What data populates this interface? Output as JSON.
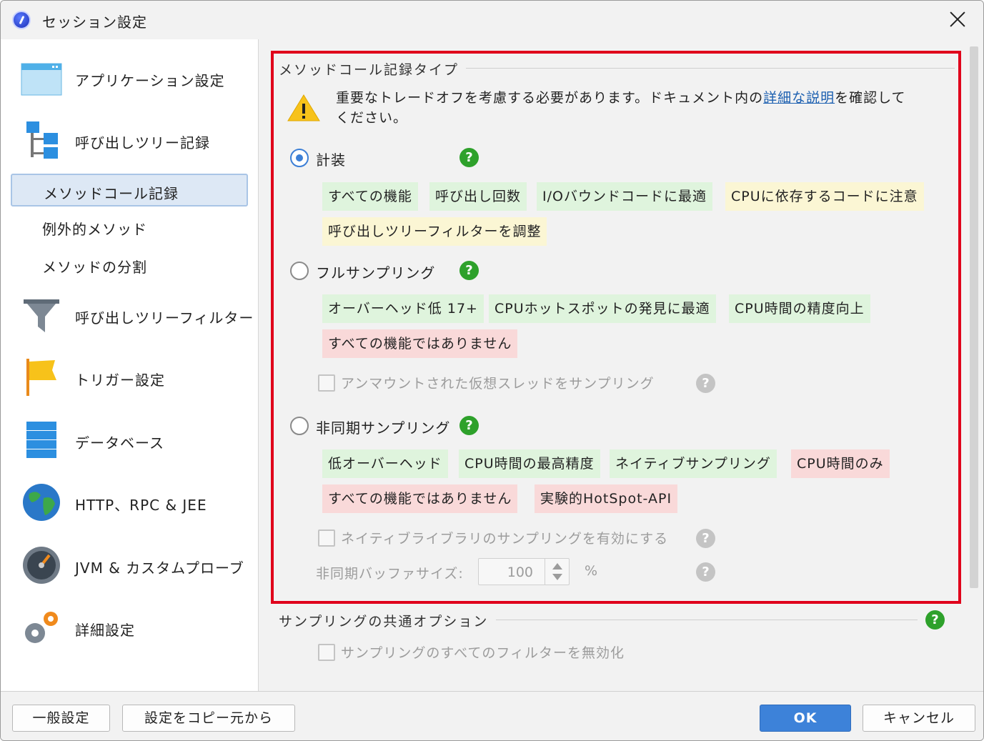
{
  "window": {
    "title": "セッション設定"
  },
  "sidebar": {
    "items": [
      {
        "label": "アプリケーション設定",
        "icon": "application-window-icon"
      },
      {
        "label": "呼び出しツリー記録",
        "icon": "tree-icon"
      },
      {
        "label": "呼び出しツリーフィルター",
        "icon": "funnel-icon"
      },
      {
        "label": "トリガー設定",
        "icon": "flag-icon"
      },
      {
        "label": "データベース",
        "icon": "database-icon"
      },
      {
        "label": "HTTP、RPC & JEE",
        "icon": "globe-icon"
      },
      {
        "label": "JVM & カスタムプローブ",
        "icon": "gauge-icon"
      },
      {
        "label": "詳細設定",
        "icon": "gears-icon"
      }
    ],
    "subitems": [
      {
        "label": "メソッドコール記録",
        "selected": true
      },
      {
        "label": "例外的メソッド",
        "selected": false
      },
      {
        "label": "メソッドの分割",
        "selected": false
      }
    ]
  },
  "main": {
    "section_title": "メソッドコール記録タイプ",
    "warning": {
      "before": "重要なトレードオフを考慮する必要があります。ドキュメント内の",
      "link": "詳細な説明",
      "after": "を確認して",
      "line2": "ください。"
    },
    "options": [
      {
        "label": "計装",
        "checked": true,
        "tags": [
          {
            "text": "すべての機能",
            "color": "green"
          },
          {
            "text": "呼び出し回数",
            "color": "green"
          },
          {
            "text": "I/Oバウンドコードに最適",
            "color": "green"
          },
          {
            "text": "CPUに依存するコードに注意",
            "color": "yellow"
          },
          {
            "text": "呼び出しツリーフィルターを調整",
            "color": "yellow"
          }
        ]
      },
      {
        "label": "フルサンプリング",
        "checked": false,
        "tags": [
          {
            "text": "オーバーヘッド低 17+",
            "color": "green"
          },
          {
            "text": "CPUホットスポットの発見に最適",
            "color": "green"
          },
          {
            "text": "CPU時間の精度向上",
            "color": "green"
          },
          {
            "text": "すべての機能ではありません",
            "color": "red"
          }
        ],
        "checkbox_label": "アンマウントされた仮想スレッドをサンプリング"
      },
      {
        "label": "非同期サンプリング",
        "checked": false,
        "tags": [
          {
            "text": "低オーバーヘッド",
            "color": "green"
          },
          {
            "text": "CPU時間の最高精度",
            "color": "green"
          },
          {
            "text": "ネイティブサンプリング",
            "color": "green"
          },
          {
            "text": "CPU時間のみ",
            "color": "red"
          },
          {
            "text": "すべての機能ではありません",
            "color": "red"
          },
          {
            "text": "実験的HotSpot-API",
            "color": "red"
          }
        ],
        "checkbox_label": "ネイティブライブラリのサンプリングを有効にする",
        "buffer": {
          "label": "非同期バッファサイズ:",
          "value": "100",
          "unit": "%"
        }
      }
    ],
    "common": {
      "section_title": "サンプリングの共通オプション",
      "checkbox_label": "サンプリングのすべてのフィルターを無効化"
    },
    "help_glyph": "?"
  },
  "footer": {
    "general": "一般設定",
    "copy": "設定をコピー元から",
    "ok": "OK",
    "cancel": "キャンセル"
  },
  "colors": {
    "highlight": "#e0001b",
    "accent": "#3d82d9",
    "help": "#2ea12b",
    "tag_green": "#dff4dd",
    "tag_yellow": "#fbf6d4",
    "tag_red": "#f9d9d9"
  }
}
